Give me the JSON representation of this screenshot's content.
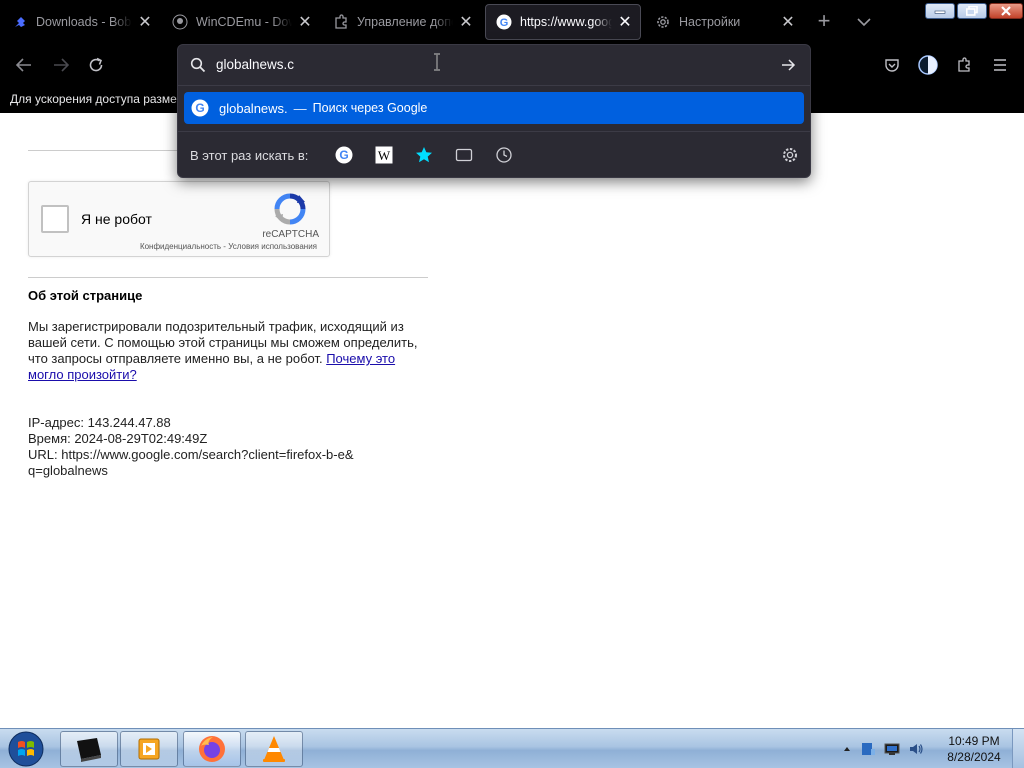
{
  "browser": {
    "tabs": [
      {
        "label": "Downloads - Bob P",
        "icon": "bob-puzzle-icon",
        "active": false
      },
      {
        "label": "WinCDEmu - Down",
        "icon": "github-icon",
        "active": false
      },
      {
        "label": "Управление допо",
        "icon": "puzzle-icon",
        "active": false
      },
      {
        "label": "https://www.googl",
        "icon": "google-icon",
        "active": true
      },
      {
        "label": "Настройки",
        "icon": "gear-icon",
        "active": false
      }
    ],
    "new_tab_label": "+",
    "notification": "Для ускорения доступа разместите закладки здесь, на панели закладок."
  },
  "urlbar": {
    "value": "globalnews.c",
    "suggestion": {
      "text": "globalnews.",
      "dash": "—",
      "action": "Поиск через Google"
    },
    "oneoff_label": "В этот раз искать в:",
    "oneoff_engines": [
      "google-icon",
      "wikipedia-icon",
      "bookmarks-star-icon",
      "tabs-icon",
      "history-clock-icon"
    ]
  },
  "page": {
    "recaptcha": {
      "label": "Я не робот",
      "brand": "reCAPTCHA",
      "links": "Конфиденциальность - Условия использования"
    },
    "about_heading": "Об этой странице",
    "about_text": "Мы зарегистрировали подозрительный трафик, исходящий из вашей сети. С помощью этой страницы мы сможем определить, что запросы отправляете именно вы, а не робот. ",
    "about_link": "Почему это могло произойти?",
    "ip_line": "IP-адрес: 143.244.47.88",
    "time_line": "Время: 2024-08-29T02:49:49Z",
    "url_line": "URL: https://www.google.com/search?client=firefox-b-e&\nq=globalnews"
  },
  "taskbar": {
    "items": [
      "terminal-icon",
      "media-player-icon",
      "firefox-icon",
      "vlc-icon"
    ],
    "clock_time": "10:49 PM",
    "clock_date": "8/28/2024"
  },
  "colors": {
    "accent": "#0060df",
    "panel": "#2b2a33",
    "toolbar": "#000000",
    "link": "#1a0dab"
  }
}
